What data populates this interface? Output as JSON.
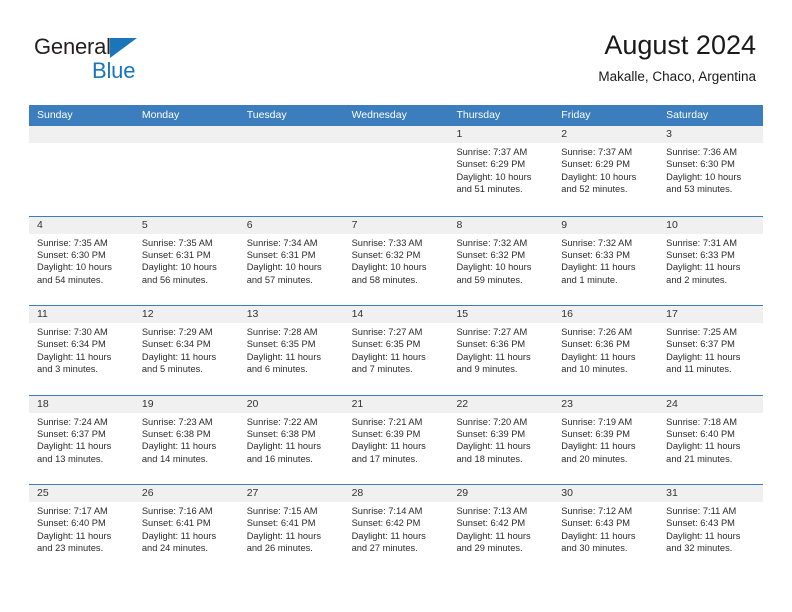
{
  "brand": {
    "name_part1": "General",
    "name_part2": "Blue",
    "accent_color": "#1b75bb"
  },
  "header": {
    "title": "August 2024",
    "subtitle": "Makalle, Chaco, Argentina"
  },
  "theme": {
    "header_row_color": "#3b7dbd",
    "day_band_color": "#f0f0f0",
    "text_color": "#2b2b2b"
  },
  "weekdays": [
    "Sunday",
    "Monday",
    "Tuesday",
    "Wednesday",
    "Thursday",
    "Friday",
    "Saturday"
  ],
  "labels": {
    "sunrise": "Sunrise:",
    "sunset": "Sunset:",
    "daylight": "Daylight:"
  },
  "weeks": [
    [
      {
        "day": "",
        "empty": true
      },
      {
        "day": "",
        "empty": true
      },
      {
        "day": "",
        "empty": true
      },
      {
        "day": "",
        "empty": true
      },
      {
        "day": "1",
        "sunrise": "Sunrise: 7:37 AM",
        "sunset": "Sunset: 6:29 PM",
        "daylight": "Daylight: 10 hours and 51 minutes."
      },
      {
        "day": "2",
        "sunrise": "Sunrise: 7:37 AM",
        "sunset": "Sunset: 6:29 PM",
        "daylight": "Daylight: 10 hours and 52 minutes."
      },
      {
        "day": "3",
        "sunrise": "Sunrise: 7:36 AM",
        "sunset": "Sunset: 6:30 PM",
        "daylight": "Daylight: 10 hours and 53 minutes."
      }
    ],
    [
      {
        "day": "4",
        "sunrise": "Sunrise: 7:35 AM",
        "sunset": "Sunset: 6:30 PM",
        "daylight": "Daylight: 10 hours and 54 minutes."
      },
      {
        "day": "5",
        "sunrise": "Sunrise: 7:35 AM",
        "sunset": "Sunset: 6:31 PM",
        "daylight": "Daylight: 10 hours and 56 minutes."
      },
      {
        "day": "6",
        "sunrise": "Sunrise: 7:34 AM",
        "sunset": "Sunset: 6:31 PM",
        "daylight": "Daylight: 10 hours and 57 minutes."
      },
      {
        "day": "7",
        "sunrise": "Sunrise: 7:33 AM",
        "sunset": "Sunset: 6:32 PM",
        "daylight": "Daylight: 10 hours and 58 minutes."
      },
      {
        "day": "8",
        "sunrise": "Sunrise: 7:32 AM",
        "sunset": "Sunset: 6:32 PM",
        "daylight": "Daylight: 10 hours and 59 minutes."
      },
      {
        "day": "9",
        "sunrise": "Sunrise: 7:32 AM",
        "sunset": "Sunset: 6:33 PM",
        "daylight": "Daylight: 11 hours and 1 minute."
      },
      {
        "day": "10",
        "sunrise": "Sunrise: 7:31 AM",
        "sunset": "Sunset: 6:33 PM",
        "daylight": "Daylight: 11 hours and 2 minutes."
      }
    ],
    [
      {
        "day": "11",
        "sunrise": "Sunrise: 7:30 AM",
        "sunset": "Sunset: 6:34 PM",
        "daylight": "Daylight: 11 hours and 3 minutes."
      },
      {
        "day": "12",
        "sunrise": "Sunrise: 7:29 AM",
        "sunset": "Sunset: 6:34 PM",
        "daylight": "Daylight: 11 hours and 5 minutes."
      },
      {
        "day": "13",
        "sunrise": "Sunrise: 7:28 AM",
        "sunset": "Sunset: 6:35 PM",
        "daylight": "Daylight: 11 hours and 6 minutes."
      },
      {
        "day": "14",
        "sunrise": "Sunrise: 7:27 AM",
        "sunset": "Sunset: 6:35 PM",
        "daylight": "Daylight: 11 hours and 7 minutes."
      },
      {
        "day": "15",
        "sunrise": "Sunrise: 7:27 AM",
        "sunset": "Sunset: 6:36 PM",
        "daylight": "Daylight: 11 hours and 9 minutes."
      },
      {
        "day": "16",
        "sunrise": "Sunrise: 7:26 AM",
        "sunset": "Sunset: 6:36 PM",
        "daylight": "Daylight: 11 hours and 10 minutes."
      },
      {
        "day": "17",
        "sunrise": "Sunrise: 7:25 AM",
        "sunset": "Sunset: 6:37 PM",
        "daylight": "Daylight: 11 hours and 11 minutes."
      }
    ],
    [
      {
        "day": "18",
        "sunrise": "Sunrise: 7:24 AM",
        "sunset": "Sunset: 6:37 PM",
        "daylight": "Daylight: 11 hours and 13 minutes."
      },
      {
        "day": "19",
        "sunrise": "Sunrise: 7:23 AM",
        "sunset": "Sunset: 6:38 PM",
        "daylight": "Daylight: 11 hours and 14 minutes."
      },
      {
        "day": "20",
        "sunrise": "Sunrise: 7:22 AM",
        "sunset": "Sunset: 6:38 PM",
        "daylight": "Daylight: 11 hours and 16 minutes."
      },
      {
        "day": "21",
        "sunrise": "Sunrise: 7:21 AM",
        "sunset": "Sunset: 6:39 PM",
        "daylight": "Daylight: 11 hours and 17 minutes."
      },
      {
        "day": "22",
        "sunrise": "Sunrise: 7:20 AM",
        "sunset": "Sunset: 6:39 PM",
        "daylight": "Daylight: 11 hours and 18 minutes."
      },
      {
        "day": "23",
        "sunrise": "Sunrise: 7:19 AM",
        "sunset": "Sunset: 6:39 PM",
        "daylight": "Daylight: 11 hours and 20 minutes."
      },
      {
        "day": "24",
        "sunrise": "Sunrise: 7:18 AM",
        "sunset": "Sunset: 6:40 PM",
        "daylight": "Daylight: 11 hours and 21 minutes."
      }
    ],
    [
      {
        "day": "25",
        "sunrise": "Sunrise: 7:17 AM",
        "sunset": "Sunset: 6:40 PM",
        "daylight": "Daylight: 11 hours and 23 minutes."
      },
      {
        "day": "26",
        "sunrise": "Sunrise: 7:16 AM",
        "sunset": "Sunset: 6:41 PM",
        "daylight": "Daylight: 11 hours and 24 minutes."
      },
      {
        "day": "27",
        "sunrise": "Sunrise: 7:15 AM",
        "sunset": "Sunset: 6:41 PM",
        "daylight": "Daylight: 11 hours and 26 minutes."
      },
      {
        "day": "28",
        "sunrise": "Sunrise: 7:14 AM",
        "sunset": "Sunset: 6:42 PM",
        "daylight": "Daylight: 11 hours and 27 minutes."
      },
      {
        "day": "29",
        "sunrise": "Sunrise: 7:13 AM",
        "sunset": "Sunset: 6:42 PM",
        "daylight": "Daylight: 11 hours and 29 minutes."
      },
      {
        "day": "30",
        "sunrise": "Sunrise: 7:12 AM",
        "sunset": "Sunset: 6:43 PM",
        "daylight": "Daylight: 11 hours and 30 minutes."
      },
      {
        "day": "31",
        "sunrise": "Sunrise: 7:11 AM",
        "sunset": "Sunset: 6:43 PM",
        "daylight": "Daylight: 11 hours and 32 minutes."
      }
    ]
  ]
}
